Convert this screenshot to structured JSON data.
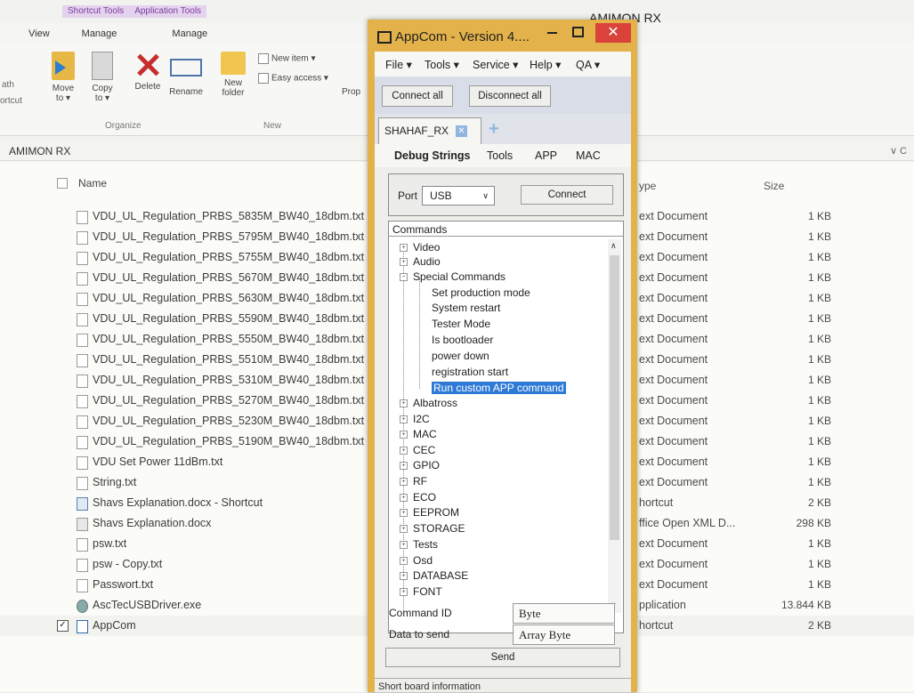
{
  "explorer": {
    "window_title": "AMIMON RX",
    "context_tabs": [
      "Shortcut Tools",
      "Application Tools"
    ],
    "ribbon_tabs": [
      "View",
      "Manage",
      "Manage"
    ],
    "ribbon_left_cut": [
      "ath",
      "ortcut"
    ],
    "organize_buttons": [
      {
        "label": "Move\nto ▾",
        "icon": "move-to-icon"
      },
      {
        "label": "Copy\nto ▾",
        "icon": "copy-to-icon"
      },
      {
        "label": "Delete",
        "icon": "delete-icon"
      },
      {
        "label": "Rename",
        "icon": "rename-icon"
      }
    ],
    "new_folder_label": "New\nfolder",
    "new_item_label": "New item ▾",
    "easy_access_label": "Easy access ▾",
    "prop_label": "Prop",
    "group_organize": "Organize",
    "group_new": "New",
    "address": "AMIMON RX",
    "address_right": "∨ C",
    "columns": {
      "name": "Name",
      "type": "ype",
      "size": "Size"
    },
    "files": [
      {
        "name": "VDU_UL_Regulation_PRBS_5835M_BW40_18dbm.txt",
        "type": "ext Document",
        "size": "1 KB"
      },
      {
        "name": "VDU_UL_Regulation_PRBS_5795M_BW40_18dbm.txt",
        "type": "ext Document",
        "size": "1 KB"
      },
      {
        "name": "VDU_UL_Regulation_PRBS_5755M_BW40_18dbm.txt",
        "type": "ext Document",
        "size": "1 KB"
      },
      {
        "name": "VDU_UL_Regulation_PRBS_5670M_BW40_18dbm.txt",
        "type": "ext Document",
        "size": "1 KB"
      },
      {
        "name": "VDU_UL_Regulation_PRBS_5630M_BW40_18dbm.txt",
        "type": "ext Document",
        "size": "1 KB"
      },
      {
        "name": "VDU_UL_Regulation_PRBS_5590M_BW40_18dbm.txt",
        "type": "ext Document",
        "size": "1 KB"
      },
      {
        "name": "VDU_UL_Regulation_PRBS_5550M_BW40_18dbm.txt",
        "type": "ext Document",
        "size": "1 KB"
      },
      {
        "name": "VDU_UL_Regulation_PRBS_5510M_BW40_18dbm.txt",
        "type": "ext Document",
        "size": "1 KB"
      },
      {
        "name": "VDU_UL_Regulation_PRBS_5310M_BW40_18dbm.txt",
        "type": "ext Document",
        "size": "1 KB"
      },
      {
        "name": "VDU_UL_Regulation_PRBS_5270M_BW40_18dbm.txt",
        "type": "ext Document",
        "size": "1 KB"
      },
      {
        "name": "VDU_UL_Regulation_PRBS_5230M_BW40_18dbm.txt",
        "type": "ext Document",
        "size": "1 KB"
      },
      {
        "name": "VDU_UL_Regulation_PRBS_5190M_BW40_18dbm.txt",
        "type": "ext Document",
        "size": "1 KB"
      },
      {
        "name": "VDU Set Power 11dBm.txt",
        "type": "ext Document",
        "size": "1 KB"
      },
      {
        "name": "String.txt",
        "type": "ext Document",
        "size": "1 KB"
      },
      {
        "name": "Shavs Explanation.docx - Shortcut",
        "type": "hortcut",
        "size": "2 KB"
      },
      {
        "name": "Shavs Explanation.docx",
        "type": "ffice Open XML D...",
        "size": "298 KB"
      },
      {
        "name": "psw.txt",
        "type": "ext Document",
        "size": "1 KB"
      },
      {
        "name": "psw - Copy.txt",
        "type": "ext Document",
        "size": "1 KB"
      },
      {
        "name": "Passwort.txt",
        "type": "ext Document",
        "size": "1 KB"
      },
      {
        "name": "AscTecUSBDriver.exe",
        "type": "pplication",
        "size": "13.844 KB"
      },
      {
        "name": "AppCom",
        "type": "hortcut",
        "size": "2 KB"
      }
    ]
  },
  "appcom": {
    "title": "AppCom - Version 4....",
    "close_glyph": "✕",
    "menu": [
      "File ▾",
      "Tools ▾",
      "Service ▾",
      "Help ▾",
      "QA ▾"
    ],
    "connect_all": "Connect all",
    "disconnect_all": "Disconnect all",
    "device_tab": "SHAHAF_RX",
    "tab_close_glyph": "✕",
    "add_tab_glyph": "+",
    "sub_tabs": [
      "Debug Strings",
      "Tools",
      "APP",
      "MAC"
    ],
    "port_label": "Port",
    "port_value": "USB",
    "connect_button": "Connect",
    "commands_header": "Commands",
    "tree_top": [
      {
        "label": "Video",
        "sign": "+"
      },
      {
        "label": "Audio",
        "sign": "+"
      },
      {
        "label": "Special Commands",
        "sign": "−"
      }
    ],
    "special_children": [
      "Set production mode",
      "System restart",
      "Tester Mode",
      "Is bootloader",
      "power down",
      "registration start",
      "Run custom APP command"
    ],
    "selected_command": "Run custom APP command",
    "tree_bottom": [
      "Albatross",
      "I2C",
      "MAC",
      "CEC",
      "GPIO",
      "RF",
      "ECO",
      "EEPROM",
      "STORAGE",
      "Tests",
      "Osd",
      "DATABASE",
      "FONT"
    ],
    "command_id_label": "Command ID",
    "command_id_value": "Byte",
    "data_to_send_label": "Data to send",
    "data_to_send_value": "Array Byte",
    "send_button": "Send",
    "status_text": "Short board information"
  }
}
